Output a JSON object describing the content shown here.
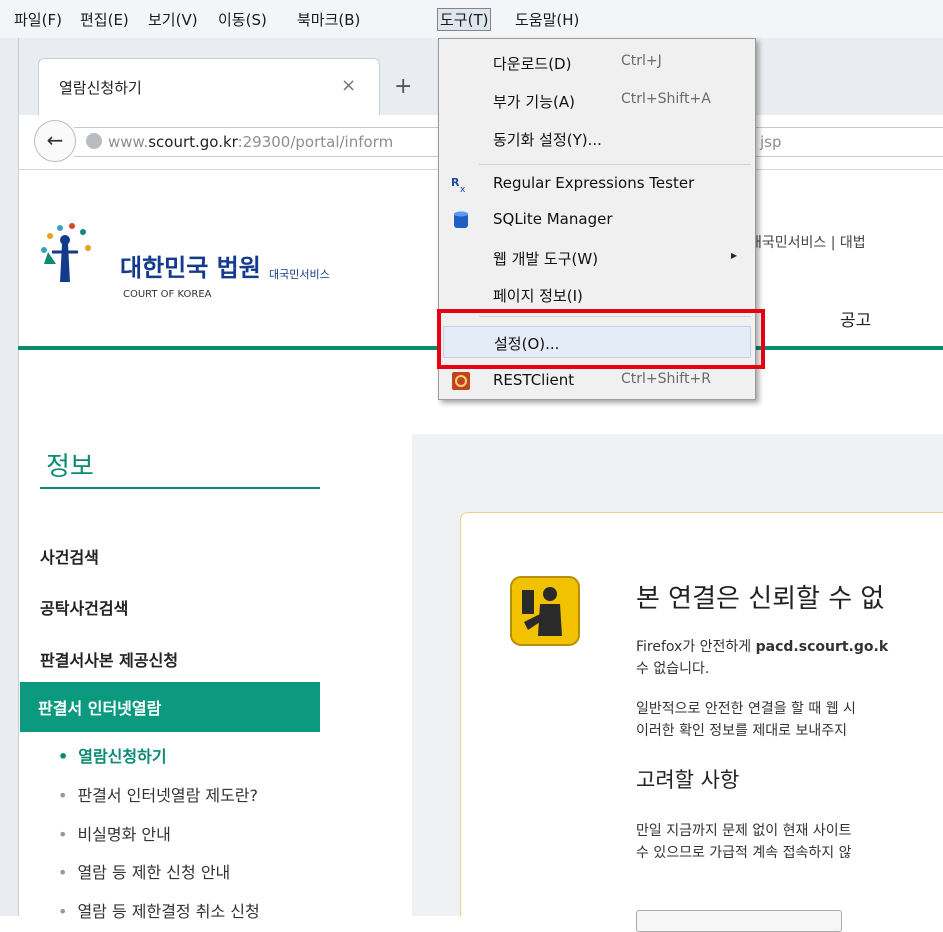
{
  "menubar": {
    "items": [
      "파일(F)",
      "편집(E)",
      "보기(V)",
      "이동(S)",
      "북마크(B)",
      "도구(T)",
      "도움말(H)"
    ]
  },
  "tab": {
    "title": "열람신청하기",
    "close": "×",
    "new_tab": "+"
  },
  "navbar": {
    "back": "←",
    "url_prefix": "www.",
    "url_domain": "scourt.go.kr",
    "url_rest": ":29300/portal/inform",
    "url_tail": "jsp"
  },
  "site": {
    "logo_ko": "대한민국 법원",
    "logo_sub": "대국민서비스",
    "logo_en": "COURT OF KOREA",
    "top_links": "대국민서비스 | 대법",
    "gnb_notice": "공고"
  },
  "sidebar": {
    "title": "정보",
    "menus": [
      "사건검색",
      "공탁사건검색",
      "판결서사본 제공신청"
    ],
    "active_menu": "판결서 인터넷열람",
    "sub_items": [
      {
        "label": "열람신청하기",
        "current": true
      },
      {
        "label": "판결서 인터넷열람 제도란?",
        "current": false
      },
      {
        "label": "비실명화 안내",
        "current": false
      },
      {
        "label": "열람 등 제한 신청 안내",
        "current": false
      },
      {
        "label": "열람 등 제한결정 취소 신청",
        "current": false
      }
    ]
  },
  "error_page": {
    "title": "본 연결은 신뢰할 수 없",
    "p1_prefix": "Firefox가 안전하게 ",
    "p1_host": "pacd.scourt.go.k",
    "p1_line2": "수 없습니다.",
    "p2_line1": "일반적으로 안전한 연결을 할 때 웹 시",
    "p2_line2": "이러한 확인 정보를 제대로 보내주지",
    "consider_heading": "고려할 사항",
    "p3_line1": "만일 지금까지 문제 없이 현재 사이트",
    "p3_line2": "수 있으므로 가급적 계속 접속하지 않"
  },
  "tools_menu": {
    "items": [
      {
        "label": "다운로드(D)",
        "shortcut": "Ctrl+J",
        "icon": ""
      },
      {
        "label": "부가 기능(A)",
        "shortcut": "Ctrl+Shift+A",
        "icon": ""
      },
      {
        "label": "동기화 설정(Y)...",
        "shortcut": "",
        "icon": ""
      },
      {
        "label": "Regular Expressions Tester",
        "shortcut": "",
        "icon": "regex-icon"
      },
      {
        "label": "SQLite Manager",
        "shortcut": "",
        "icon": "database-icon"
      },
      {
        "label": "웹 개발 도구(W)",
        "shortcut": "",
        "icon": "",
        "submenu_arrow": "▸"
      },
      {
        "label": "페이지 정보(I)",
        "shortcut": "",
        "icon": ""
      },
      {
        "label": "설정(O)...",
        "shortcut": "",
        "icon": ""
      },
      {
        "label": "RESTClient",
        "shortcut": "Ctrl+Shift+R",
        "icon": "restclient-icon"
      }
    ]
  },
  "colors": {
    "brand_green": "#0b8a74",
    "highlight_red": "#e60012",
    "logo_blue": "#133a8c"
  }
}
